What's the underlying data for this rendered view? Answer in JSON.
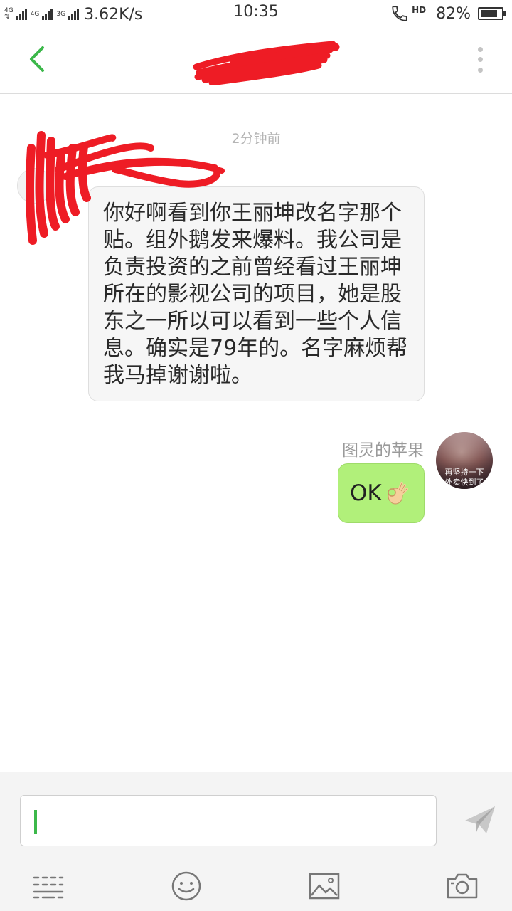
{
  "status_bar": {
    "network_1": "4G",
    "network_2": "4G",
    "network_3": "3G",
    "speed": "3.62K/s",
    "time": "10:35",
    "hd": "HD",
    "battery_percent": "82%",
    "battery_level": 0.82
  },
  "header": {
    "title": ""
  },
  "chat": {
    "time_label": "2分钟前",
    "messages": [
      {
        "side": "left",
        "text": "你好啊看到你王丽坤改名字那个贴。组外鹅发来爆料。我公司是负责投资的之前曾经看过王丽坤所在的影视公司的项目，她是股东之一所以可以看到一些个人信息。确实是79年的。名字麻烦帮我马掉谢谢啦。"
      },
      {
        "side": "right",
        "sender": "图灵的苹果",
        "text": "OK",
        "emoji": "ok-hand-icon",
        "avatar_caption_1": "再坚持一下",
        "avatar_caption_2": "外卖快到了"
      }
    ]
  },
  "input": {
    "value": ""
  },
  "colors": {
    "accent_green": "#3cb84a",
    "sent_bubble": "#b1f07a",
    "received_bubble": "#f6f6f6",
    "redaction": "#ee1c25"
  }
}
